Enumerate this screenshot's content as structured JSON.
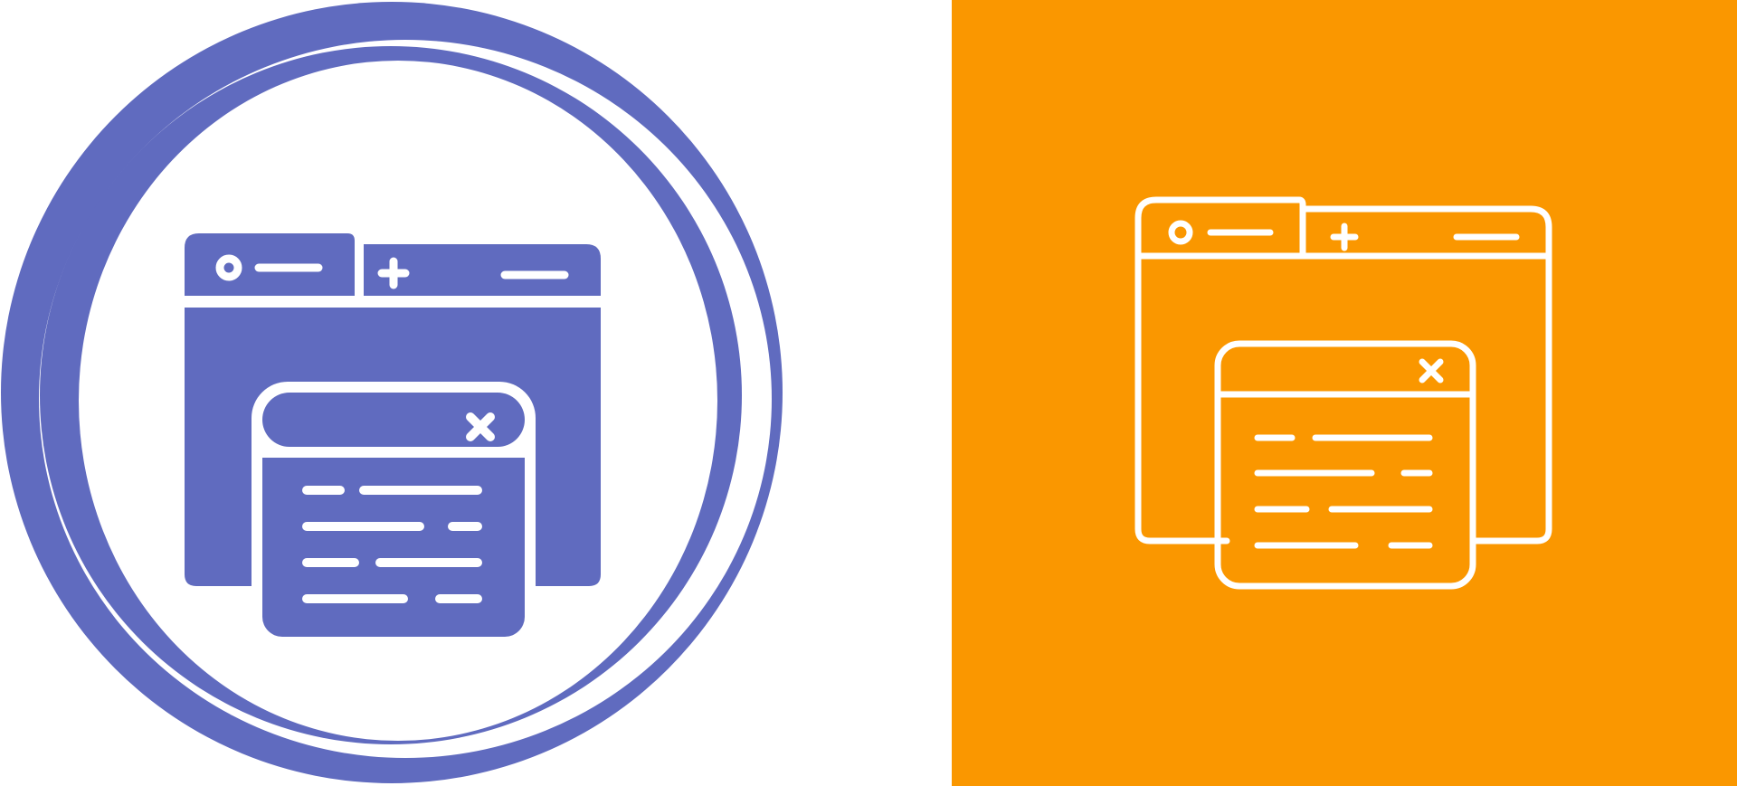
{
  "colors": {
    "primary": "#606bbf",
    "accent_background": "#fa9700",
    "white": "#ffffff"
  },
  "icons": {
    "glyph_variant": {
      "name": "browser-windows-glyph-icon",
      "style": "filled",
      "frame": "double-ring-circle"
    },
    "line_variant": {
      "name": "browser-windows-line-icon",
      "style": "outline",
      "frame": "solid-square"
    }
  },
  "icon_glyphs": {
    "tab_dot": "circle",
    "tab_add": "plus",
    "popup_close": "cross"
  }
}
